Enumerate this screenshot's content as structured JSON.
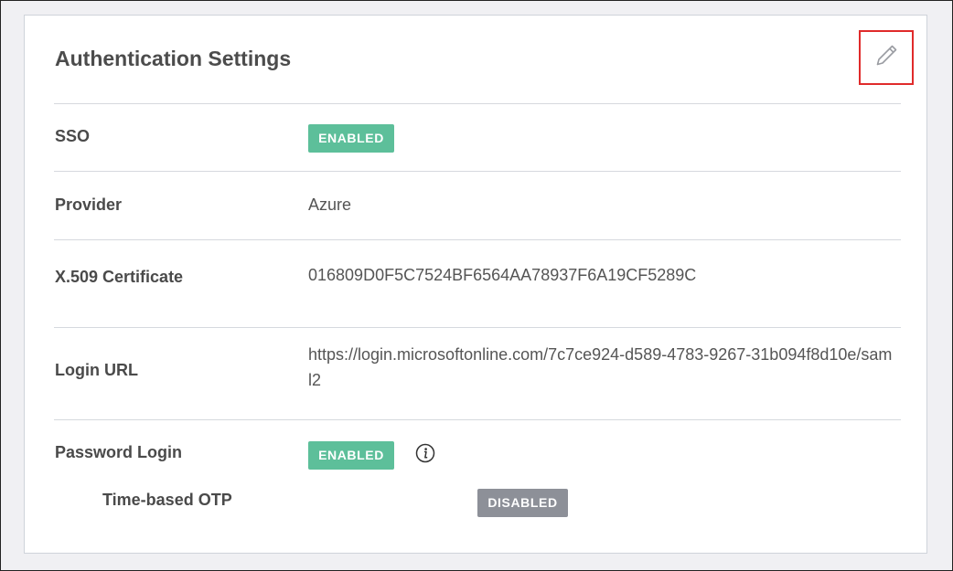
{
  "panel": {
    "title": "Authentication Settings",
    "edit_icon": "pencil-icon"
  },
  "rows": {
    "sso": {
      "label": "SSO",
      "badge": "ENABLED"
    },
    "provider": {
      "label": "Provider",
      "value": "Azure"
    },
    "certificate": {
      "label": "X.509 Certificate",
      "value": "016809D0F5C7524BF6564AA78937F6A19CF5289C"
    },
    "login_url": {
      "label": "Login URL",
      "value": "https://login.microsoftonline.com/7c7ce924-d589-4783-9267-31b094f8d10e/saml2"
    },
    "password_login": {
      "label": "Password Login",
      "badge": "ENABLED",
      "info_icon": "info-icon"
    },
    "otp": {
      "label": "Time-based OTP",
      "badge": "DISABLED"
    }
  },
  "colors": {
    "enabled": "#5dbf9a",
    "disabled": "#8d9098",
    "highlight": "#e02b2b"
  }
}
